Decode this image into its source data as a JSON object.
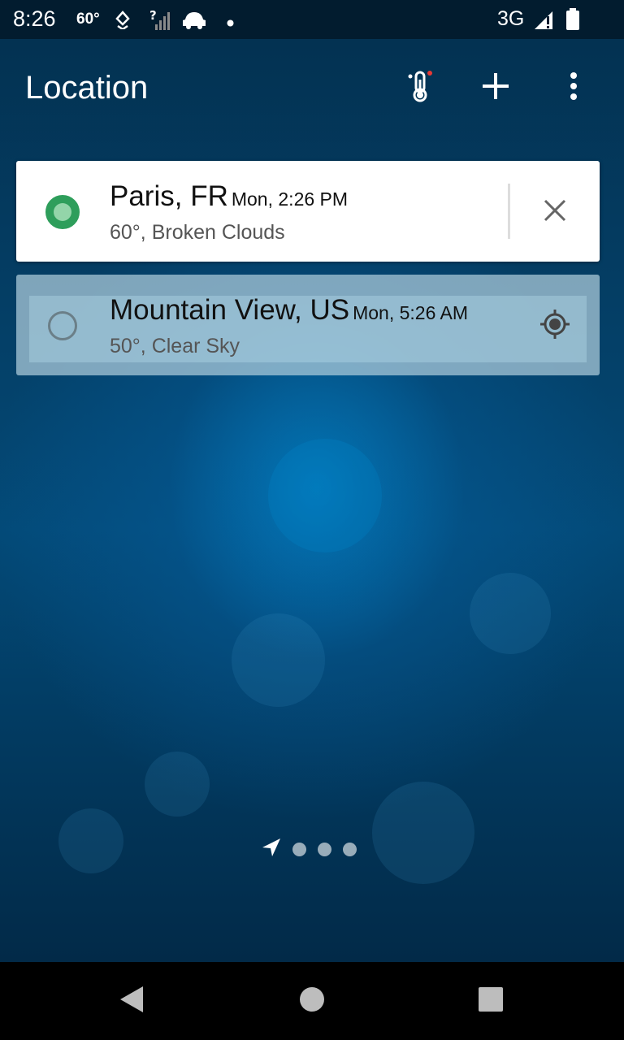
{
  "status_bar": {
    "time": "8:26",
    "temperature": "60°",
    "network": "3G",
    "icons": [
      "weather-drop-icon",
      "signal-unknown-icon",
      "car-icon",
      "notification-dot-icon",
      "cell-signal-icon",
      "battery-icon"
    ]
  },
  "app_bar": {
    "title": "Location",
    "actions": [
      "thermometer-icon",
      "add-icon",
      "more-vert-icon"
    ]
  },
  "locations": [
    {
      "city": "Paris, FR",
      "time": "Mon, 2:26 PM",
      "weather": "60°, Broken Clouds",
      "selected": true,
      "action_icon": "close-icon"
    },
    {
      "city": "Mountain View, US",
      "time": "Mon, 5:26 AM",
      "weather": "50°, Clear Sky",
      "selected": false,
      "action_icon": "gps-location-icon"
    }
  ],
  "pager": {
    "icons": [
      "navigation-arrow-icon"
    ],
    "dot_count": 3
  },
  "nav_bar": {
    "icons": [
      "back-icon",
      "home-icon",
      "recents-icon"
    ]
  },
  "colors": {
    "selected_radio": "#2e9e5b",
    "unselected_radio": "#6b7f88",
    "background": "#04426b",
    "card": "#ffffff"
  }
}
